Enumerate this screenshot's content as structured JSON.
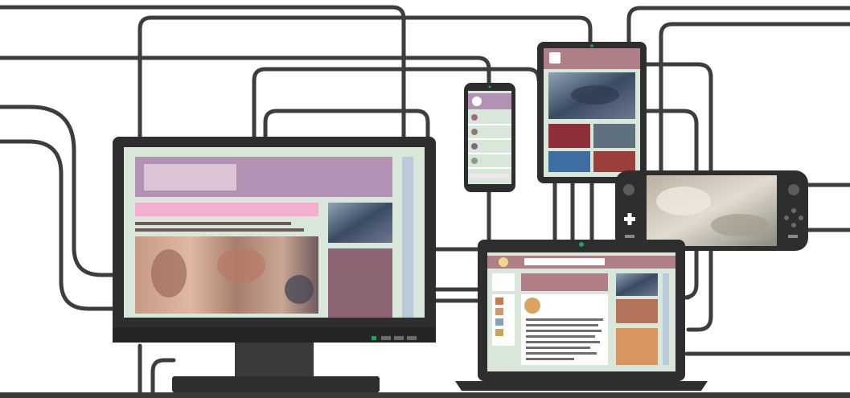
{
  "illustration": {
    "description_icon": "multi-device-network-illustration",
    "devices": [
      {
        "name": "desktop-monitor",
        "icon": "monitor-icon"
      },
      {
        "name": "smartphone",
        "icon": "phone-icon"
      },
      {
        "name": "tablet",
        "icon": "tablet-icon"
      },
      {
        "name": "handheld-game-console",
        "icon": "gamepad-icon"
      },
      {
        "name": "laptop",
        "icon": "laptop-icon"
      }
    ]
  },
  "colors": {
    "background": "#ffffff",
    "cable": "#3d3d3d",
    "device_frame": "#2e2e2e",
    "screen_bg": "#d8e7d9",
    "header_purple": "#b292b4",
    "header_block_light": "#dcc4d6",
    "pink_bar": "#f2afd0",
    "text_line": "#6e5858",
    "sidebar_blue": "#b9cadb",
    "mauve_panel": "#8b6573",
    "laptop_header": "#b07e86",
    "laptop_orange": "#d8955f",
    "sun_yellow": "#eed88a",
    "power_led": "#1fa35a",
    "floor": "#3a3a3a"
  }
}
